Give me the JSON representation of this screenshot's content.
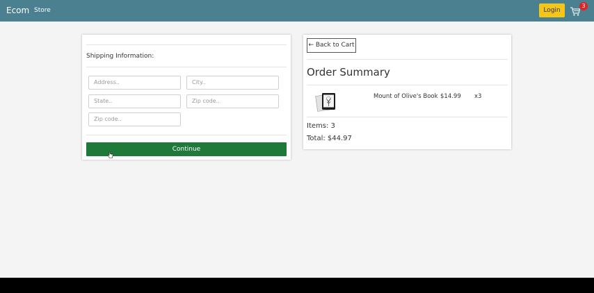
{
  "navbar": {
    "brand": "Ecom",
    "store_link": "Store",
    "login_label": "Login",
    "cart_icon": "cart-icon",
    "cart_count": "3",
    "background": "#4a8090"
  },
  "shipping": {
    "title": "Shipping Information:",
    "address_placeholder": "Address..",
    "city_placeholder": "City..",
    "state_placeholder": "State..",
    "zip_placeholder": "Zip code..",
    "zip2_placeholder": "Zip code..",
    "continue_label": "Continue",
    "continue_color": "#1f7a3a"
  },
  "summary": {
    "back_label": "← Back to Cart",
    "title": "Order Summary",
    "items": [
      {
        "name": "Mount of Olive's Book",
        "price": "$14.99",
        "qty": "x3",
        "thumb_icon": "book-thumbnail-icon"
      }
    ],
    "items_count": "Items: 3",
    "total": "Total: $44.97"
  },
  "accent": {
    "login_color": "#f5c518",
    "badge_color": "#e02424"
  }
}
